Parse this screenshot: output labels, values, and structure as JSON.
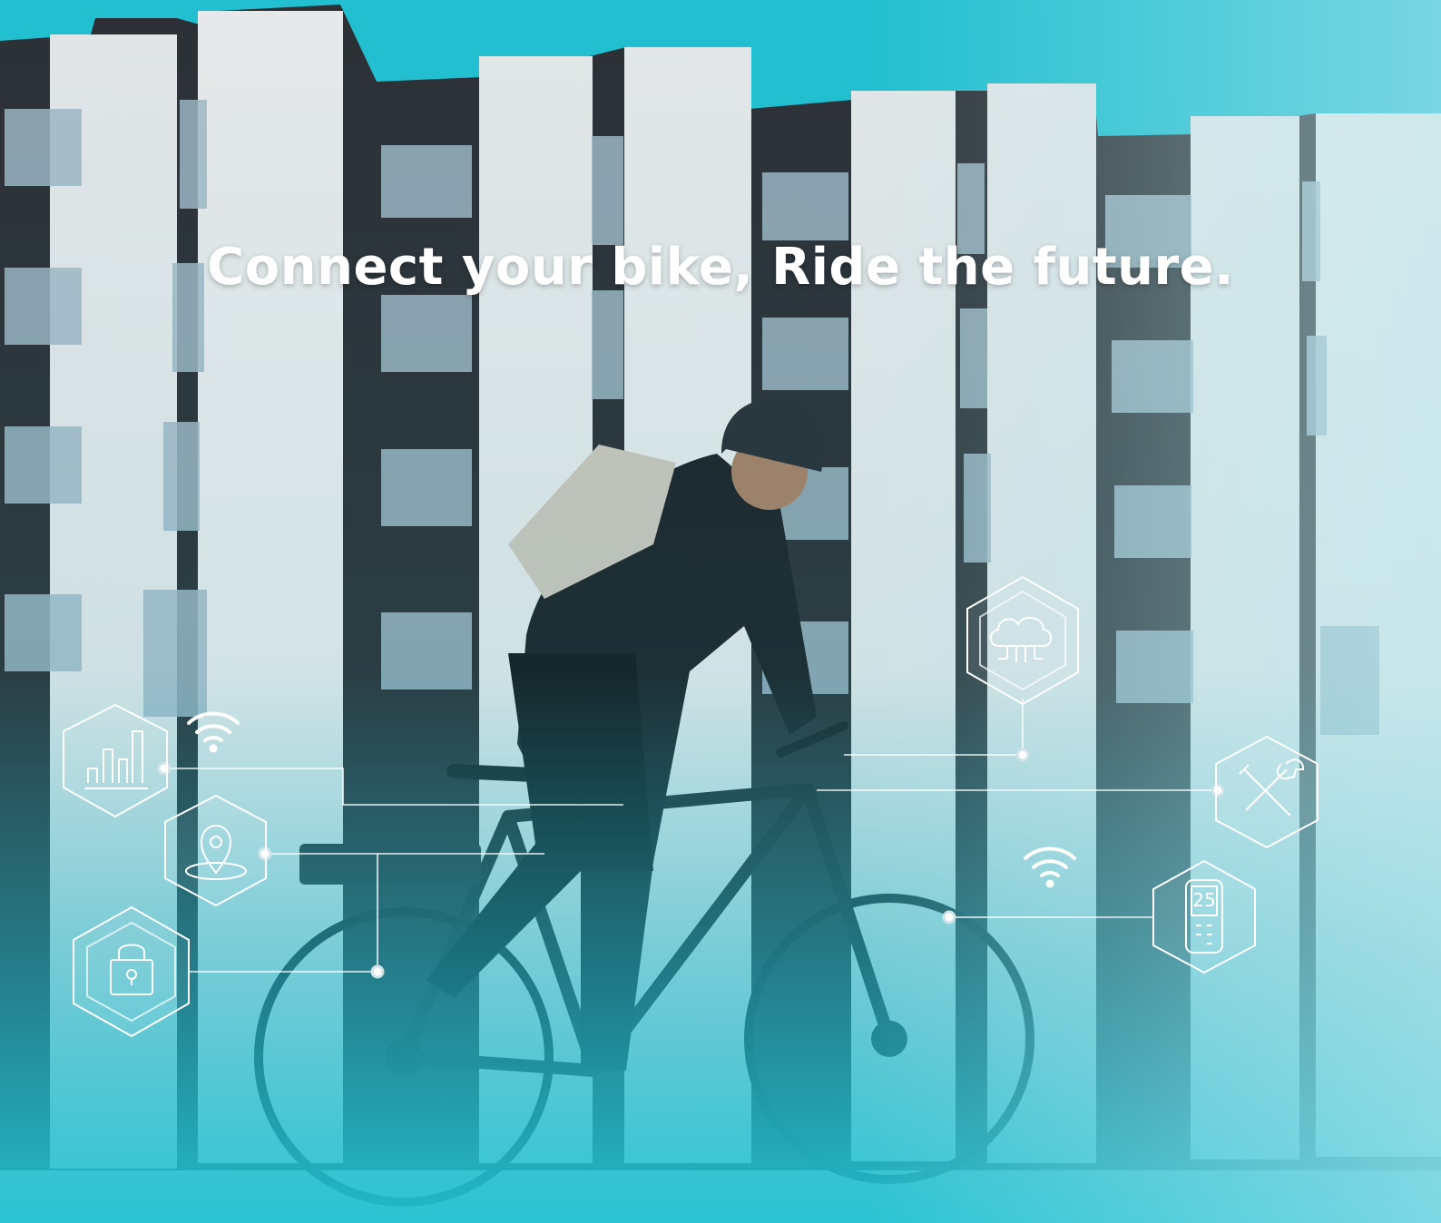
{
  "hero": {
    "headline": "Connect your bike, Ride the future."
  },
  "features": [
    {
      "icon": "bar-chart-icon",
      "meaning": "analytics"
    },
    {
      "icon": "location-pin-icon",
      "meaning": "gps"
    },
    {
      "icon": "padlock-icon",
      "meaning": "security"
    },
    {
      "icon": "cloud-network-icon",
      "meaning": "cloud"
    },
    {
      "icon": "wrench-screwdriver-icon",
      "meaning": "service"
    },
    {
      "icon": "bike-display-icon",
      "meaning": "display"
    }
  ],
  "display_readout": "25",
  "colors": {
    "sky": "#21bfd0",
    "building_light": "#dfe3e4",
    "building_dark": "#2b2f33",
    "overlay_teal": "#1fb6c8",
    "line_white": "#ffffff"
  }
}
